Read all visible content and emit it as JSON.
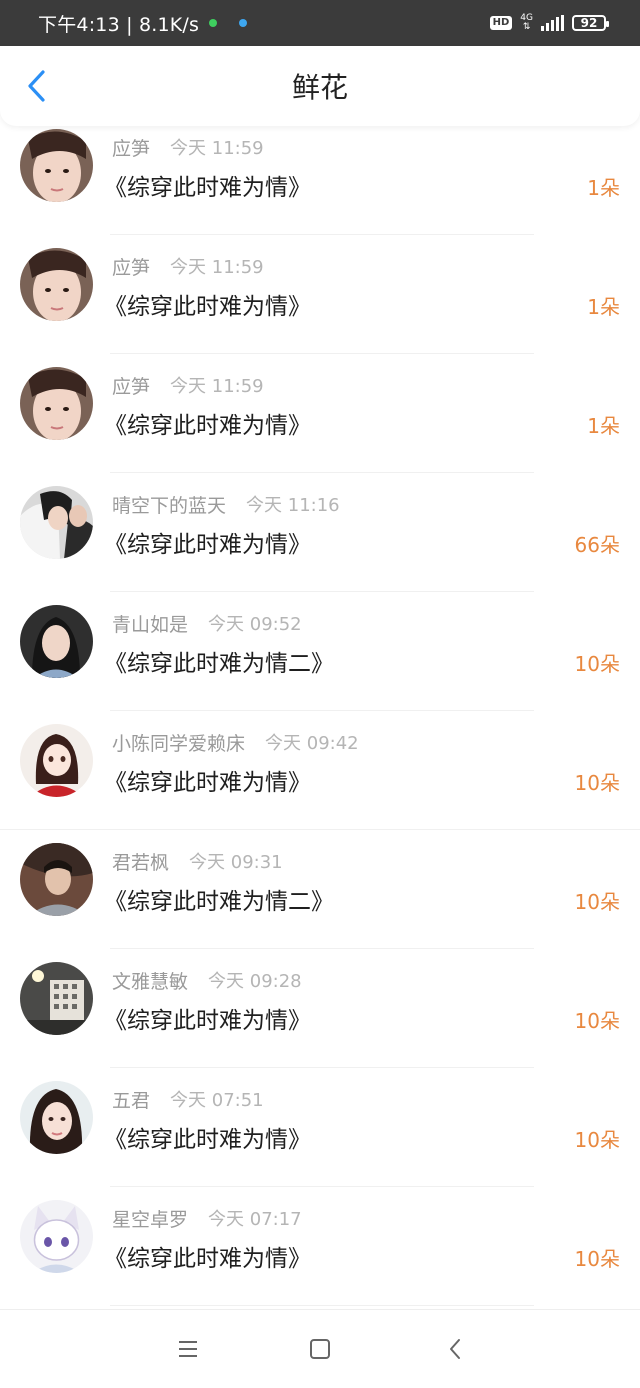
{
  "status_bar": {
    "time_speed": "下午4:13 | 8.1K/s",
    "hd": "HD",
    "network": "4G",
    "battery": "92"
  },
  "header": {
    "title": "鲜花"
  },
  "rows": [
    {
      "user": "应笋",
      "time": "今天 11:59",
      "book": "《综穿此时难为情》",
      "count": "1朵",
      "avatar": "portrait-woman"
    },
    {
      "user": "应笋",
      "time": "今天 11:59",
      "book": "《综穿此时难为情》",
      "count": "1朵",
      "avatar": "portrait-woman"
    },
    {
      "user": "应笋",
      "time": "今天 11:59",
      "book": "《综穿此时难为情》",
      "count": "1朵",
      "avatar": "portrait-woman"
    },
    {
      "user": "晴空下的蓝天",
      "time": "今天 11:16",
      "book": "《综穿此时难为情》",
      "count": "66朵",
      "avatar": "costume-couple"
    },
    {
      "user": "青山如是",
      "time": "今天 09:52",
      "book": "《综穿此时难为情二》",
      "count": "10朵",
      "avatar": "portrait-woman-dark"
    },
    {
      "user": "小陈同学爱赖床",
      "time": "今天 09:42",
      "book": "《综穿此时难为情》",
      "count": "10朵",
      "avatar": "cartoon-girl"
    },
    {
      "user": "君若枫",
      "time": "今天 09:31",
      "book": "《综穿此时难为情二》",
      "count": "10朵",
      "avatar": "costume-man"
    },
    {
      "user": "文雅慧敏",
      "time": "今天 09:28",
      "book": "《综穿此时难为情》",
      "count": "10朵",
      "avatar": "night-building"
    },
    {
      "user": "五君",
      "time": "今天 07:51",
      "book": "《综穿此时难为情》",
      "count": "10朵",
      "avatar": "portrait-woman-light"
    },
    {
      "user": "星空卓罗",
      "time": "今天 07:17",
      "book": "《综穿此时难为情》",
      "count": "10朵",
      "avatar": "anime-fox"
    }
  ],
  "nav": {
    "menu": "menu-icon",
    "home": "square-icon",
    "back": "back-icon"
  },
  "colors": {
    "accent_blue": "#2b8ff5",
    "count_orange": "#e8883f"
  }
}
